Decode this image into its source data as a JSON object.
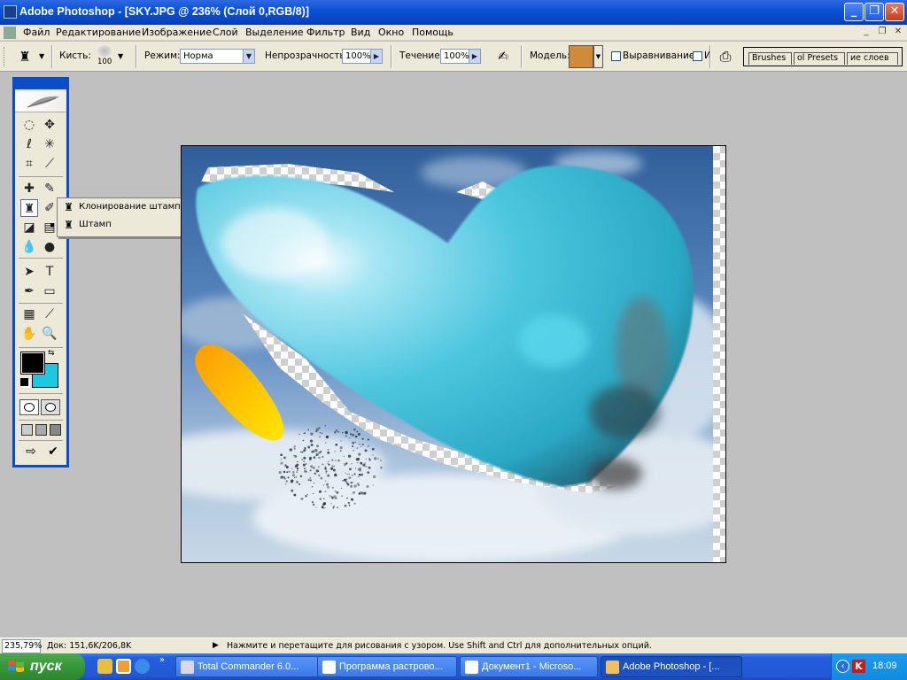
{
  "window": {
    "title": "Adobe Photoshop - [SKY.JPG @ 236% (Слой 0,RGB/8)]",
    "controls": [
      "_",
      "❐",
      "✕"
    ]
  },
  "menu": {
    "items": [
      "Файл",
      "Редактирование",
      "Изображение",
      "Слой",
      "Выделение",
      "Фильтр",
      "Вид",
      "Окно",
      "Помощь"
    ],
    "doc_controls": [
      "_",
      "❐",
      "✕"
    ]
  },
  "options": {
    "brush_label": "Кисть:",
    "brush_size": "100",
    "mode_label": "Режим:",
    "mode_value": "Норма",
    "opacity_label": "Непрозрачность:",
    "opacity_value": "100%",
    "flow_label": "Течение:",
    "flow_value": "100%",
    "pattern_label": "Модель:",
    "pattern_color": "#d08a3a",
    "aligned_label": "Выравнивание",
    "impressionist_label": "И",
    "palette_tabs": [
      "Brushes",
      "ol Presets",
      "ие слоев"
    ]
  },
  "toolbox": {
    "tools": [
      {
        "name": "marquee-tool-icon",
        "glyph": "◌"
      },
      {
        "name": "move-tool-icon",
        "glyph": "✥"
      },
      {
        "name": "lasso-tool-icon",
        "glyph": "ℓ"
      },
      {
        "name": "magic-wand-tool-icon",
        "glyph": "✳"
      },
      {
        "name": "crop-tool-icon",
        "glyph": "⌗"
      },
      {
        "name": "slice-tool-icon",
        "glyph": "⟋"
      },
      {
        "name": "healing-brush-tool-icon",
        "glyph": "✚"
      },
      {
        "name": "brush-tool-icon",
        "glyph": "✎"
      },
      {
        "name": "stamp-tool-icon",
        "glyph": "♜"
      },
      {
        "name": "history-brush-tool-icon",
        "glyph": "✐"
      },
      {
        "name": "eraser-tool-icon",
        "glyph": "◪"
      },
      {
        "name": "gradient-tool-icon",
        "glyph": "▤"
      },
      {
        "name": "blur-tool-icon",
        "glyph": "💧"
      },
      {
        "name": "dodge-tool-icon",
        "glyph": "●"
      },
      {
        "name": "path-select-tool-icon",
        "glyph": "➤"
      },
      {
        "name": "type-tool-icon",
        "glyph": "T"
      },
      {
        "name": "pen-tool-icon",
        "glyph": "✒"
      },
      {
        "name": "shape-tool-icon",
        "glyph": "▭"
      },
      {
        "name": "notes-tool-icon",
        "glyph": "▦"
      },
      {
        "name": "eyedropper-tool-icon",
        "glyph": "⟋"
      },
      {
        "name": "hand-tool-icon",
        "glyph": "✋"
      },
      {
        "name": "zoom-tool-icon",
        "glyph": "🔍"
      }
    ],
    "foreground_color": "#000000",
    "background_color": "#1ec8e0"
  },
  "flyout": {
    "items": [
      {
        "label": "Клонирование штампа",
        "key": "S",
        "selected": false
      },
      {
        "label": "Штамп",
        "key": "S",
        "selected": true
      }
    ]
  },
  "status": {
    "zoom": "235,79%",
    "doc": "Док: 151,6K/206,8K",
    "message": "Нажмите и перетащите для рисования с узором.  Use Shift and Ctrl для дополнительных опций."
  },
  "taskbar": {
    "start_label": "пуск",
    "buttons": [
      {
        "label": "Total Commander 6.0...",
        "color": "#d8d8e8",
        "active": false
      },
      {
        "label": "Программа растрово...",
        "color": "#ffffff",
        "active": false
      },
      {
        "label": "Документ1 - Microso...",
        "color": "#ffffff",
        "active": false
      },
      {
        "label": "Adobe Photoshop - [...",
        "color": "#f0c060",
        "active": true
      }
    ],
    "clock": "18:09"
  }
}
